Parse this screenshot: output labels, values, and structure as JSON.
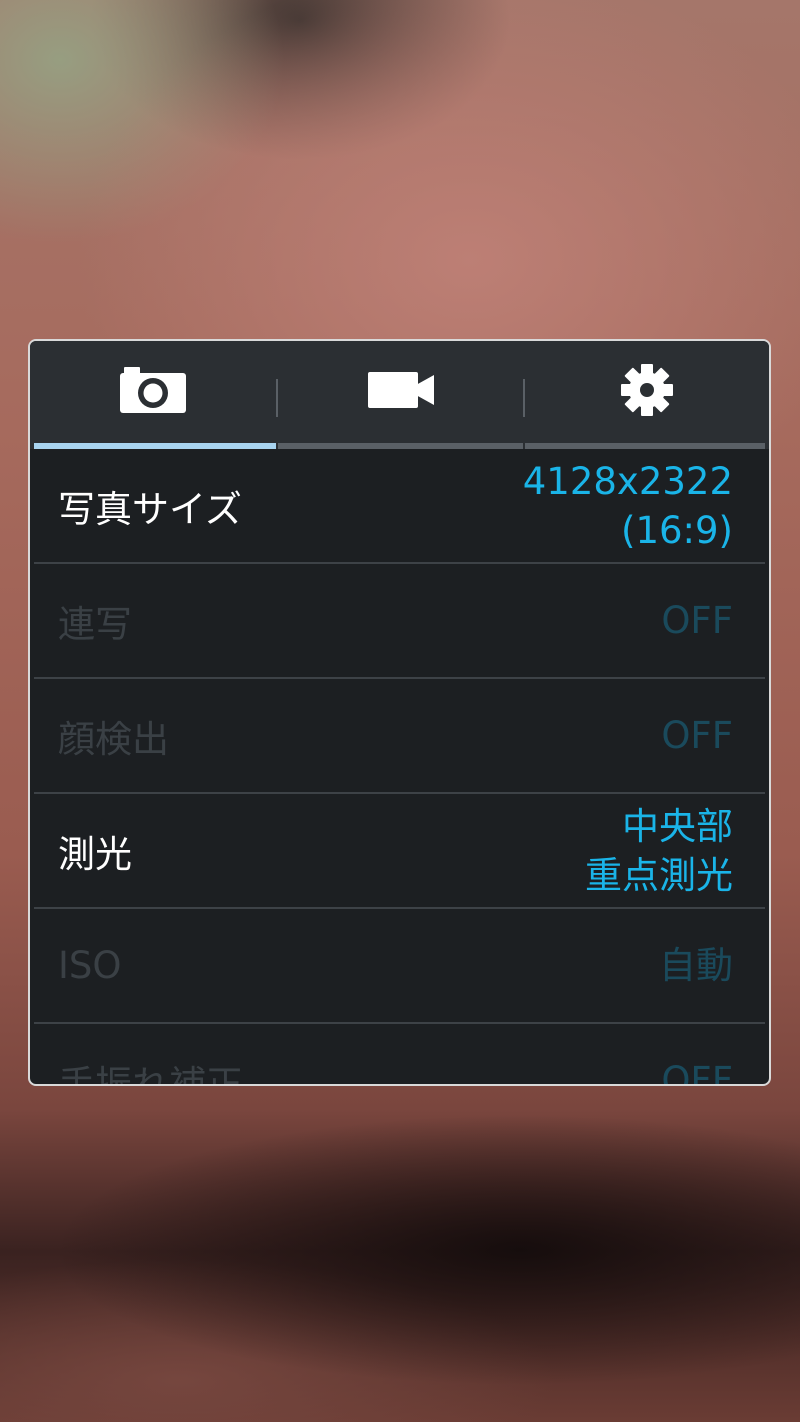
{
  "tabs": [
    {
      "name": "camera",
      "icon": "camera-icon",
      "active": true
    },
    {
      "name": "video",
      "icon": "video-camera-icon",
      "active": false
    },
    {
      "name": "settings",
      "icon": "gear-icon",
      "active": false
    }
  ],
  "settings": [
    {
      "label": "写真サイズ",
      "value_line1": "4128x2322",
      "value_line2": "(16:9)",
      "enabled": true
    },
    {
      "label": "連写",
      "value_line1": "OFF",
      "value_line2": "",
      "enabled": false
    },
    {
      "label": "顔検出",
      "value_line1": "OFF",
      "value_line2": "",
      "enabled": false
    },
    {
      "label": "測光",
      "value_line1": "中央部",
      "value_line2": "重点測光",
      "enabled": true
    },
    {
      "label": "ISO",
      "value_line1": "自動",
      "value_line2": "",
      "enabled": false
    },
    {
      "label": "手振れ補正",
      "value_line1": "OFF",
      "value_line2": "",
      "enabled": false
    }
  ],
  "colors": {
    "accent": "#1ab4e8",
    "tab_indicator_active": "#a8d4f0",
    "tab_indicator_inactive": "#5a6066",
    "panel_bg": "#1c1f22",
    "tab_bar_bg": "#2b2f33"
  }
}
